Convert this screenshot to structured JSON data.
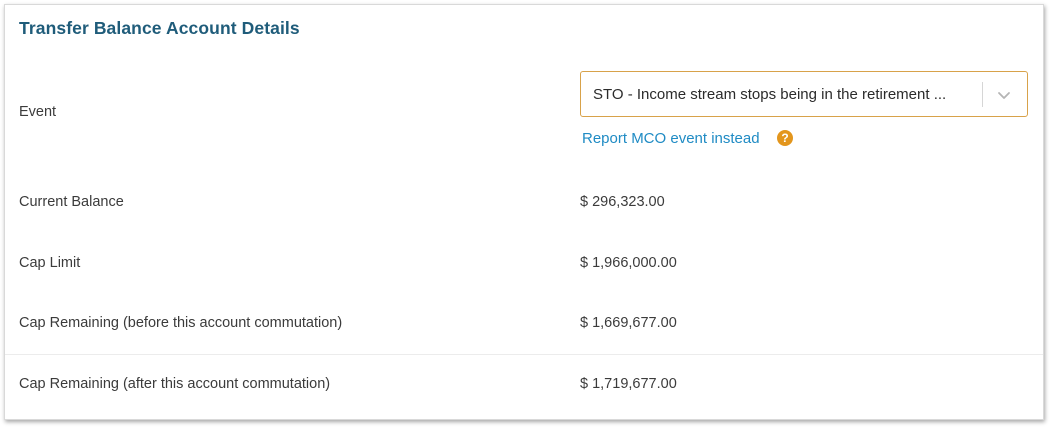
{
  "section": {
    "title": "Transfer Balance Account Details"
  },
  "event": {
    "label": "Event",
    "selected": "STO - Income stream stops being in the retirement ...",
    "link_text": "Report MCO event instead",
    "help_glyph": "?"
  },
  "rows": [
    {
      "label": "Current Balance",
      "value": "$ 296,323.00"
    },
    {
      "label": "Cap Limit",
      "value": "$ 1,966,000.00"
    },
    {
      "label": "Cap Remaining (before this account commutation)",
      "value": "$ 1,669,677.00"
    },
    {
      "label": "Cap Remaining (after this account commutation)",
      "value": "$ 1,719,677.00"
    }
  ],
  "colors": {
    "title": "#1f5c7a",
    "link": "#1f8bc4",
    "select_border": "#d8a24a",
    "help_icon": "#e3961d"
  },
  "icons": {
    "dropdown": "chevron-down-icon",
    "help": "question-circle-icon"
  }
}
